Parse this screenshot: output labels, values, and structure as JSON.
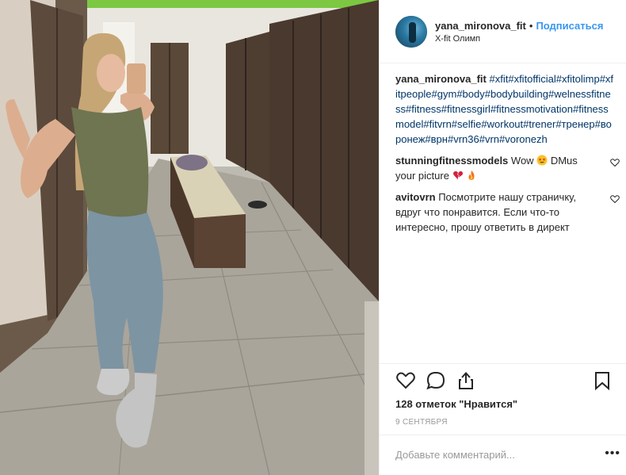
{
  "post": {
    "username": "yana_mironova_fit",
    "separator": "•",
    "follow_label": "Подписаться",
    "location": "X-fit Олимп",
    "caption_user": "yana_mironova_fit",
    "caption_text": "#xfit#xfitofficial#xfitolimp#xfitpeople#gym#body#bodybuilding#welnessfitness#fitness#fitnessgirl#fitnessmotivation#fitnessmodel#fitvrn#selfie#workout#trener#тренер#воронеж#врн#vrn36#vrn#voronezh",
    "comments": [
      {
        "user": "stunningfitnessmodels",
        "text_a": "Wow",
        "text_b": " DMus your picture",
        "emoji_1": "star-struck",
        "emoji_2": "broken-heart",
        "emoji_3": "fire"
      },
      {
        "user": "avitovrn",
        "text": "Посмотрите нашу страничку, вдруг что понравится. Если что-то интересно, прошу ответить в директ"
      }
    ],
    "likes_text": "128 отметок \"Нравится\"",
    "date": "9 СЕНТЯБРЯ",
    "add_comment_placeholder": "Добавьте комментарий...",
    "more_label": "•••"
  },
  "colors": {
    "accent": "#3897f0",
    "hashtag": "#003569",
    "muted": "#999999",
    "text": "#262626"
  },
  "icons": [
    "heart-icon",
    "comment-icon",
    "share-icon",
    "bookmark-icon",
    "small-heart-icon",
    "more-icon"
  ]
}
